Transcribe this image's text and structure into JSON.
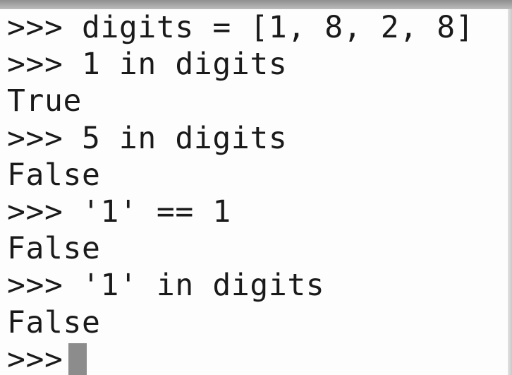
{
  "terminal": {
    "prompt": ">>> ",
    "lines": [
      {
        "kind": "input",
        "text": "digits = [1, 8, 2, 8]"
      },
      {
        "kind": "input",
        "text": "1 in digits"
      },
      {
        "kind": "output",
        "text": "True"
      },
      {
        "kind": "input",
        "text": "5 in digits"
      },
      {
        "kind": "output",
        "text": "False"
      },
      {
        "kind": "input",
        "text": "'1' == 1"
      },
      {
        "kind": "output",
        "text": "False"
      },
      {
        "kind": "input",
        "text": "'1' in digits"
      },
      {
        "kind": "output",
        "text": "False"
      }
    ],
    "final_prompt": ">>>"
  },
  "colors": {
    "background": "#fdfdfd",
    "text": "#1a1a1a",
    "cursor": "#8c8c8c"
  }
}
